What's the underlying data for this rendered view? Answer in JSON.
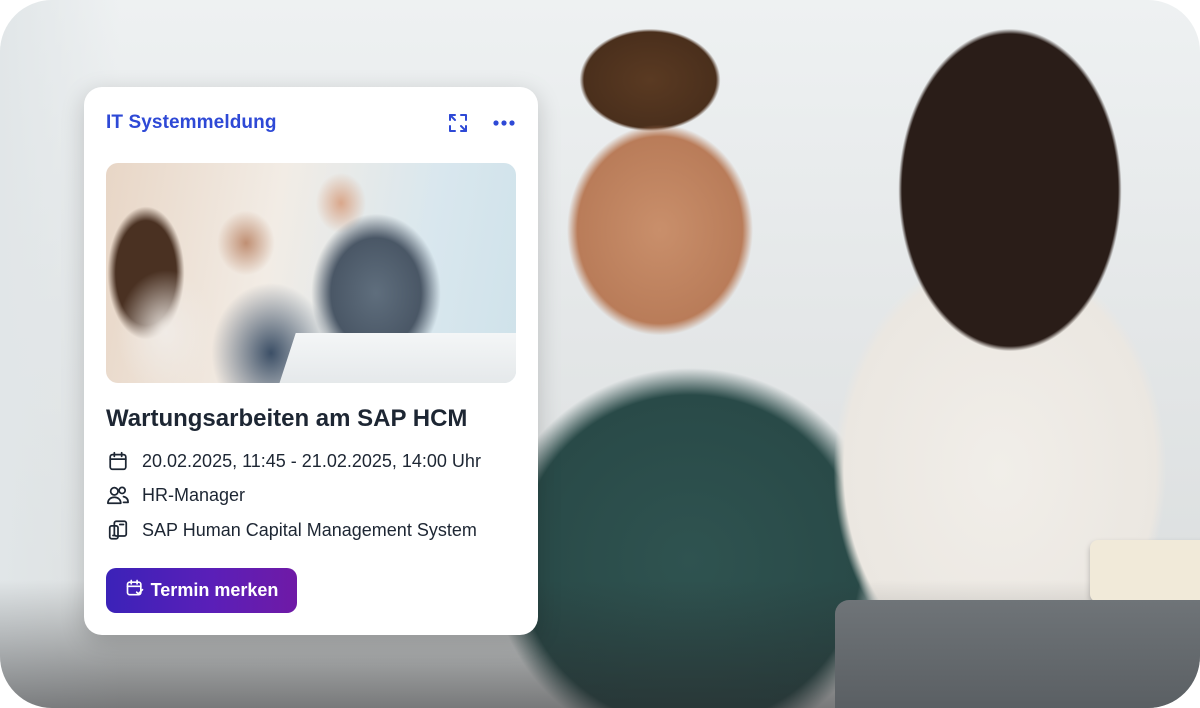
{
  "card": {
    "title": "IT Systemmeldung",
    "expand_icon": "expand-icon",
    "more_icon": "more-horizontal-icon",
    "image_alt": "Kollegen besprechen sich am Arbeitsplatz",
    "heading": "Wartungsarbeiten am SAP HCM",
    "details": {
      "date_range": "20.02.2025, 11:45 - 21.02.2025, 14:00 Uhr",
      "audience": "HR-Manager",
      "system": "SAP Human Capital Management System"
    },
    "cta_label": "Termin merken",
    "cta_icon": "calendar-check-icon"
  },
  "colors": {
    "title_blue": "#2e49d6",
    "text_dark": "#1d2633",
    "cta_gradient_start": "#3b22b8",
    "cta_gradient_end": "#6f1aa6"
  }
}
